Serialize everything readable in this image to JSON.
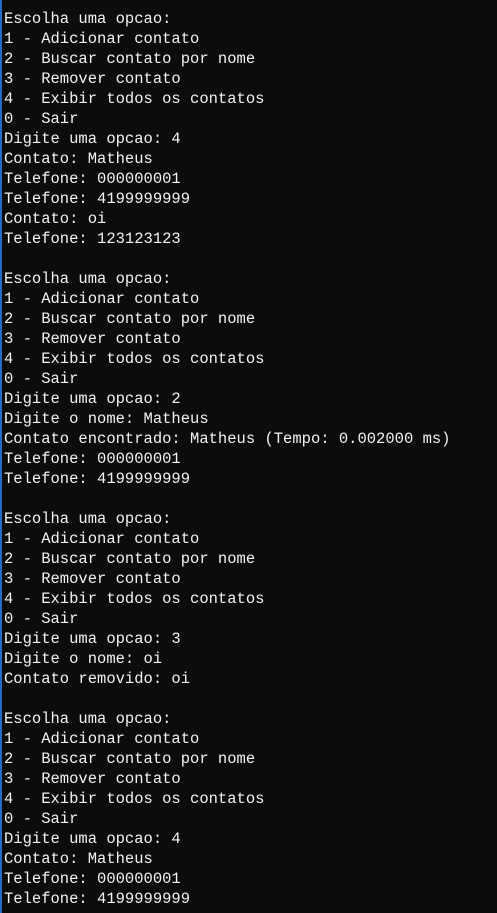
{
  "console": {
    "lines": [
      "Escolha uma opcao:",
      "1 - Adicionar contato",
      "2 - Buscar contato por nome",
      "3 - Remover contato",
      "4 - Exibir todos os contatos",
      "0 - Sair",
      "Digite uma opcao: 4",
      "Contato: Matheus",
      "Telefone: 000000001",
      "Telefone: 4199999999",
      "Contato: oi",
      "Telefone: 123123123",
      "",
      "Escolha uma opcao:",
      "1 - Adicionar contato",
      "2 - Buscar contato por nome",
      "3 - Remover contato",
      "4 - Exibir todos os contatos",
      "0 - Sair",
      "Digite uma opcao: 2",
      "Digite o nome: Matheus",
      "Contato encontrado: Matheus (Tempo: 0.002000 ms)",
      "Telefone: 000000001",
      "Telefone: 4199999999",
      "",
      "Escolha uma opcao:",
      "1 - Adicionar contato",
      "2 - Buscar contato por nome",
      "3 - Remover contato",
      "4 - Exibir todos os contatos",
      "0 - Sair",
      "Digite uma opcao: 3",
      "Digite o nome: oi",
      "Contato removido: oi",
      "",
      "Escolha uma opcao:",
      "1 - Adicionar contato",
      "2 - Buscar contato por nome",
      "3 - Remover contato",
      "4 - Exibir todos os contatos",
      "0 - Sair",
      "Digite uma opcao: 4",
      "Contato: Matheus",
      "Telefone: 000000001",
      "Telefone: 4199999999"
    ]
  }
}
